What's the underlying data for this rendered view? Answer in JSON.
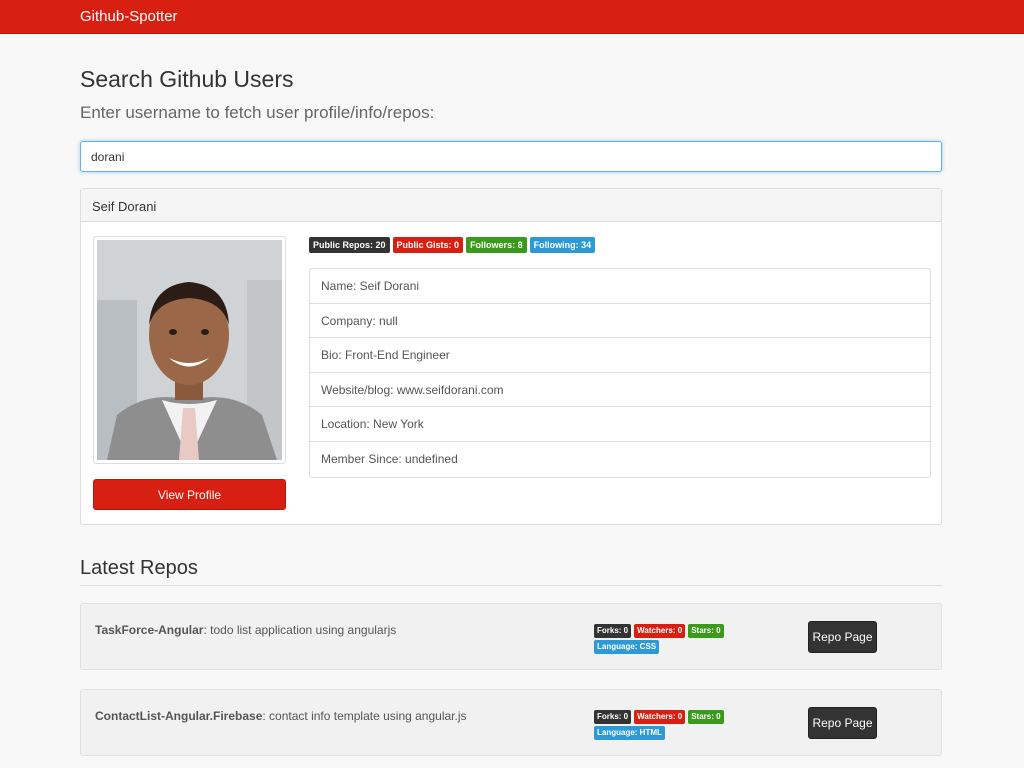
{
  "navbar": {
    "brand": "Github-Spotter"
  },
  "search": {
    "title": "Search Github Users",
    "subtitle": "Enter username to fetch user profile/info/repos:",
    "value": "dorani"
  },
  "profile": {
    "heading": "Seif Dorani",
    "view_profile_label": "View Profile",
    "badges": [
      {
        "label": "Public Repos: 20",
        "color": "#333333"
      },
      {
        "label": "Public Gists: 0",
        "color": "#d72012"
      },
      {
        "label": "Followers: 8",
        "color": "#3a9a1c"
      },
      {
        "label": "Following: 34",
        "color": "#2d9ad6"
      }
    ],
    "info": [
      "Name: Seif Dorani",
      "Company: null",
      "Bio: Front-End Engineer",
      "Website/blog: www.seifdorani.com",
      "Location: New York",
      "Member Since: undefined"
    ]
  },
  "repos": {
    "title": "Latest Repos",
    "items": [
      {
        "name": "TaskForce-Angular",
        "description": ": todo list application using angularjs",
        "forks": "Forks: 0",
        "watchers": "Watchers: 0",
        "stars": "Stars: 0",
        "language": "Language: CSS",
        "button": "Repo Page"
      },
      {
        "name": "ContactList-Angular.Firebase",
        "description": ": contact info template using angular.js",
        "forks": "Forks: 0",
        "watchers": "Watchers: 0",
        "stars": "Stars: 0",
        "language": "Language: HTML",
        "button": "Repo Page"
      }
    ]
  },
  "colors": {
    "brand_red": "#d72012",
    "dark": "#333333",
    "green": "#3a9a1c",
    "blue": "#2d9ad6"
  }
}
